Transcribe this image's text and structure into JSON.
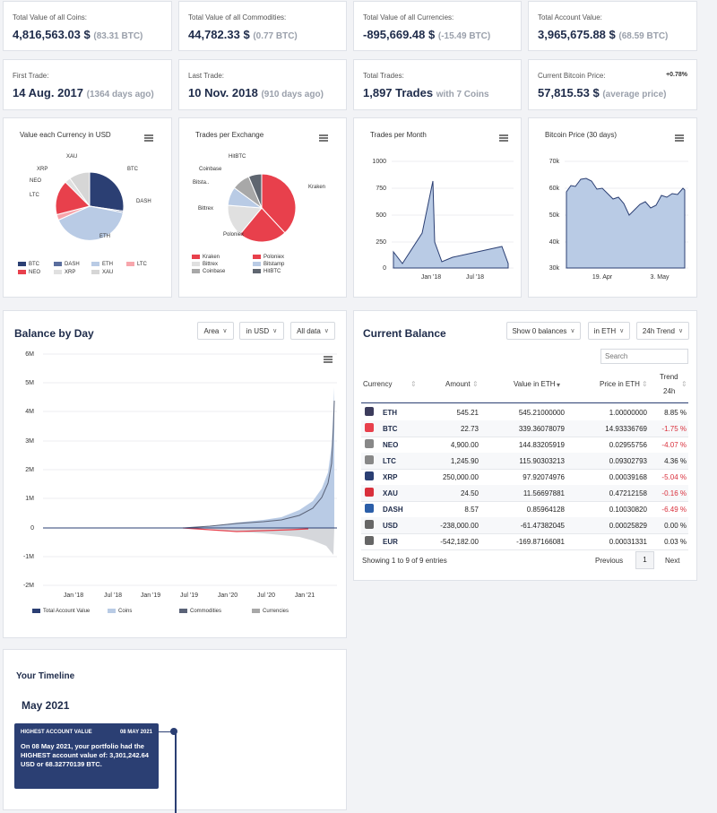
{
  "stats_row1": [
    {
      "label": "Total Value of all Coins:",
      "value": "4,816,563.03 $",
      "sub": "(83.31 BTC)"
    },
    {
      "label": "Total Value of all Commodities:",
      "value": "44,782.33 $",
      "sub": "(0.77 BTC)"
    },
    {
      "label": "Total Value of all Currencies:",
      "value": "-895,669.48 $",
      "sub": "(-15.49 BTC)"
    },
    {
      "label": "Total Account Value:",
      "value": "3,965,675.88 $",
      "sub": "(68.59 BTC)"
    }
  ],
  "stats_row2": [
    {
      "label": "First Trade:",
      "value": "14 Aug. 2017",
      "sub": "(1364 days ago)"
    },
    {
      "label": "Last Trade:",
      "value": "10 Nov. 2018",
      "sub": "(910 days ago)"
    },
    {
      "label": "Total Trades:",
      "value": "1,897 Trades",
      "sub": "with 7 Coins"
    },
    {
      "label": "Current Bitcoin Price:",
      "value": "57,815.53 $",
      "sub": "(average price)",
      "extra": "+0.78%"
    }
  ],
  "mini_charts": {
    "currency_pie": {
      "title": "Value each Currency in USD",
      "labels": [
        "XAU",
        "XRP",
        "NEO",
        "LTC",
        "BTC",
        "DASH",
        "ETH"
      ],
      "legend": [
        "BTC",
        "DASH",
        "ETH",
        "LTC",
        "NEO",
        "XRP",
        "XAU"
      ]
    },
    "exchange_pie": {
      "title": "Trades per Exchange",
      "labels": [
        "HitBTC",
        "Coinbase",
        "Bitsta..",
        "Bittrex",
        "Poloniex",
        "Kraken"
      ],
      "legend": [
        "Kraken",
        "Poloniex",
        "Bittrex",
        "Bitstamp",
        "Coinbase",
        "HitBTC"
      ]
    },
    "trades_month": {
      "title": "Trades per Month",
      "yticks": [
        "1000",
        "750",
        "500",
        "250",
        "0"
      ],
      "xticks": [
        "Jan '18",
        "Jul '18"
      ]
    },
    "btc_price": {
      "title": "Bitcoin Price (30 days)",
      "yticks": [
        "70k",
        "60k",
        "50k",
        "40k",
        "30k"
      ],
      "xticks": [
        "19. Apr",
        "3. May"
      ]
    }
  },
  "colors": {
    "navy": "#2b3f73",
    "light_blue": "#b9cbe5",
    "red": "#e8404c",
    "light_gray": "#d9d9d9",
    "gray": "#999999",
    "accent": "#1e2b4a"
  },
  "chart_data": [
    {
      "type": "pie",
      "title": "Value each Currency in USD",
      "categories": [
        "BTC",
        "DASH",
        "ETH",
        "LTC",
        "NEO",
        "XRP",
        "XAU"
      ],
      "values": [
        20,
        1,
        54,
        2,
        13,
        2,
        8
      ]
    },
    {
      "type": "pie",
      "title": "Trades per Exchange",
      "categories": [
        "Kraken",
        "Poloniex",
        "Bittrex",
        "Bitstamp",
        "Coinbase",
        "HitBTC"
      ],
      "values": [
        37,
        27,
        16,
        9,
        5,
        6
      ]
    },
    {
      "type": "area",
      "title": "Trades per Month",
      "x": [
        "Sep '17",
        "Nov '17",
        "Jan '18",
        "Feb '18",
        "Mar '18",
        "Jul '18",
        "Nov '18",
        "Dec '18"
      ],
      "values": [
        150,
        40,
        480,
        800,
        60,
        110,
        210,
        20
      ],
      "ylim": [
        0,
        1000
      ]
    },
    {
      "type": "area",
      "title": "Bitcoin Price (30 days)",
      "x": [
        "Apr 8",
        "Apr 11",
        "Apr 14",
        "Apr 17",
        "Apr 20",
        "Apr 23",
        "Apr 26",
        "Apr 29",
        "May 2",
        "May 5",
        "May 8"
      ],
      "values": [
        58,
        61,
        63,
        59,
        55,
        50,
        53,
        55,
        54,
        56,
        59
      ],
      "ylim": [
        30,
        70
      ],
      "ylabel": "k"
    },
    {
      "type": "area",
      "title": "Balance by Day",
      "x": [
        "Jan '18",
        "Jul '18",
        "Jan '19",
        "Jul '19",
        "Jan '20",
        "Jul '20",
        "Jan '21"
      ],
      "series": [
        {
          "name": "Total Account Value",
          "values": [
            0,
            0,
            0,
            0,
            0.05,
            0.2,
            4.5
          ]
        },
        {
          "name": "Coins",
          "values": [
            0,
            0,
            0,
            0,
            0.1,
            0.3,
            4.8
          ]
        },
        {
          "name": "Commodities",
          "values": [
            0,
            0,
            0,
            0,
            0,
            0,
            0.05
          ]
        },
        {
          "name": "Currencies",
          "values": [
            0,
            0,
            0,
            0,
            -0.05,
            -0.2,
            -0.9
          ]
        }
      ],
      "yticks": [
        "6M",
        "5M",
        "4M",
        "3M",
        "2M",
        "1M",
        "0",
        "-1M",
        "-2M"
      ],
      "ylim": [
        -2,
        6
      ]
    }
  ],
  "balance_by_day": {
    "title": "Balance by Day",
    "dropdowns": [
      "Area",
      "in USD",
      "All data"
    ],
    "yticks": [
      "6M",
      "5M",
      "4M",
      "3M",
      "2M",
      "1M",
      "0",
      "-1M",
      "-2M"
    ],
    "xticks": [
      "Jan '18",
      "Jul '18",
      "Jan '19",
      "Jul '19",
      "Jan '20",
      "Jul '20",
      "Jan '21"
    ],
    "legend": [
      "Total Account Value",
      "Coins",
      "Commodities",
      "Currencies"
    ]
  },
  "current_balance": {
    "title": "Current Balance",
    "dropdowns": [
      "Show 0 balances",
      "in ETH",
      "24h Trend"
    ],
    "search_placeholder": "Search",
    "headers": [
      "Currency",
      "Amount",
      "Value in ETH",
      "Price in ETH",
      "Trend",
      "24h"
    ],
    "rows": [
      {
        "cur": "ETH",
        "amt": "545.21",
        "val": "545.21000000",
        "pr": "1.00000000",
        "tr": "8.85 %",
        "icon": "ethereum-icon",
        "color": "#3c3c5c",
        "neg": false
      },
      {
        "cur": "BTC",
        "amt": "22.73",
        "val": "339.36078079",
        "pr": "14.93336769",
        "tr": "-1.75 %",
        "icon": "bitcoin-icon",
        "color": "#e8404c",
        "neg": true
      },
      {
        "cur": "NEO",
        "amt": "4,900.00",
        "val": "144.83205919",
        "pr": "0.02955756",
        "tr": "-4.07 %",
        "icon": "neo-icon",
        "color": "#888",
        "neg": true
      },
      {
        "cur": "LTC",
        "amt": "1,245.90",
        "val": "115.90303213",
        "pr": "0.09302793",
        "tr": "4.36 %",
        "icon": "litecoin-icon",
        "color": "#888",
        "neg": false
      },
      {
        "cur": "XRP",
        "amt": "250,000.00",
        "val": "97.92074976",
        "pr": "0.00039168",
        "tr": "-5.04 %",
        "icon": "ripple-icon",
        "color": "#2b3f73",
        "neg": true
      },
      {
        "cur": "XAU",
        "amt": "24.50",
        "val": "11.56697881",
        "pr": "0.47212158",
        "tr": "-0.16 %",
        "icon": "gold-icon",
        "color": "#d9303c",
        "neg": true
      },
      {
        "cur": "DASH",
        "amt": "8.57",
        "val": "0.85964128",
        "pr": "0.10030820",
        "tr": "-6.49 %",
        "icon": "dash-icon",
        "color": "#2b5ea8",
        "neg": true
      },
      {
        "cur": "USD",
        "amt": "-238,000.00",
        "val": "-61.47382045",
        "pr": "0.00025829",
        "tr": "0.00 %",
        "icon": "dollar-icon",
        "color": "#666",
        "neg": false
      },
      {
        "cur": "EUR",
        "amt": "-542,182.00",
        "val": "-169.87166081",
        "pr": "0.00031331",
        "tr": "0.03 %",
        "icon": "euro-icon",
        "color": "#666",
        "neg": false
      }
    ],
    "showing": "Showing 1 to 9 of 9 entries",
    "prev": "Previous",
    "page": "1",
    "next": "Next"
  },
  "timeline": {
    "title": "Your Timeline",
    "month": "May 2021",
    "card_title": "HIGHEST ACCOUNT VALUE",
    "card_date": "08 MAY 2021",
    "card_text": "On 08 May 2021, your portfolio had the HIGHEST account value of: 3,301,242.64 USD or 68.32770139 BTC."
  }
}
